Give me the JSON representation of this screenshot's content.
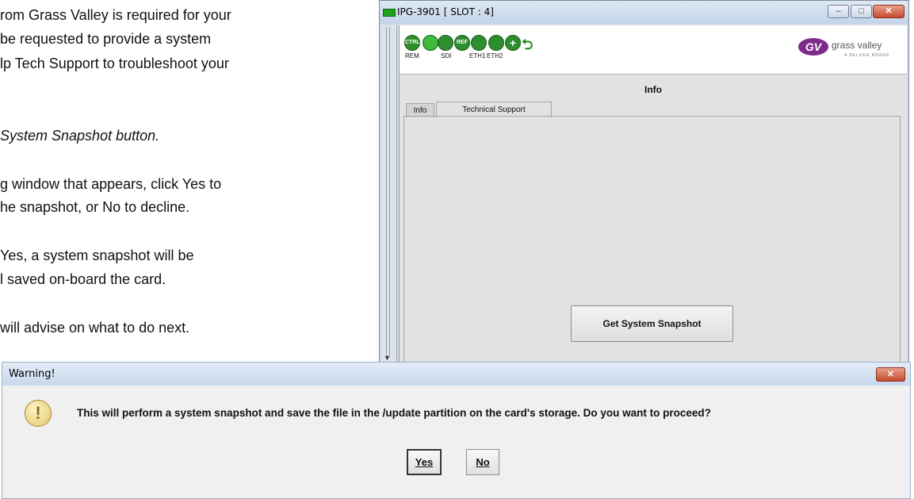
{
  "document": {
    "lines": [
      "rom Grass Valley is required for your",
      "be requested to provide a system",
      "lp Tech Support to troubleshoot your",
      "System Snapshot button.",
      "g window that appears, click  Yes to",
      "he snapshot, or No to decline.",
      "Yes, a system snapshot will be",
      "l saved on-board the card.",
      "will advise on what to do next."
    ]
  },
  "ipg_window": {
    "title": "IPG-3901 [ SLOT : 4]",
    "controls": {
      "minimize": "–",
      "maximize": "□",
      "close": "✕"
    },
    "status_leds": [
      {
        "text": "CTRL",
        "label": "REM"
      },
      {
        "text": "",
        "label": ""
      },
      {
        "text": "",
        "label": "SDI"
      },
      {
        "text": "REF",
        "label": ""
      },
      {
        "text": "",
        "label": "ETH1"
      },
      {
        "text": "",
        "label": "ETH2"
      },
      {
        "text": "+",
        "label": ""
      }
    ],
    "logo": {
      "text": "grass valley",
      "sub": "A BELDEN BRAND"
    },
    "panel_title": "Info",
    "tabs": [
      {
        "label": "Info"
      },
      {
        "label": "Technical Support"
      }
    ],
    "snapshot_button": "Get System Snapshot"
  },
  "dialog": {
    "title": "Warning!",
    "close": "✕",
    "icon": "warning-exclamation-icon",
    "message": "This will perform a system snapshot and save the file in the /update partition on the card's storage. Do you want to proceed?",
    "buttons": {
      "yes": "Yes",
      "no": "No"
    }
  }
}
